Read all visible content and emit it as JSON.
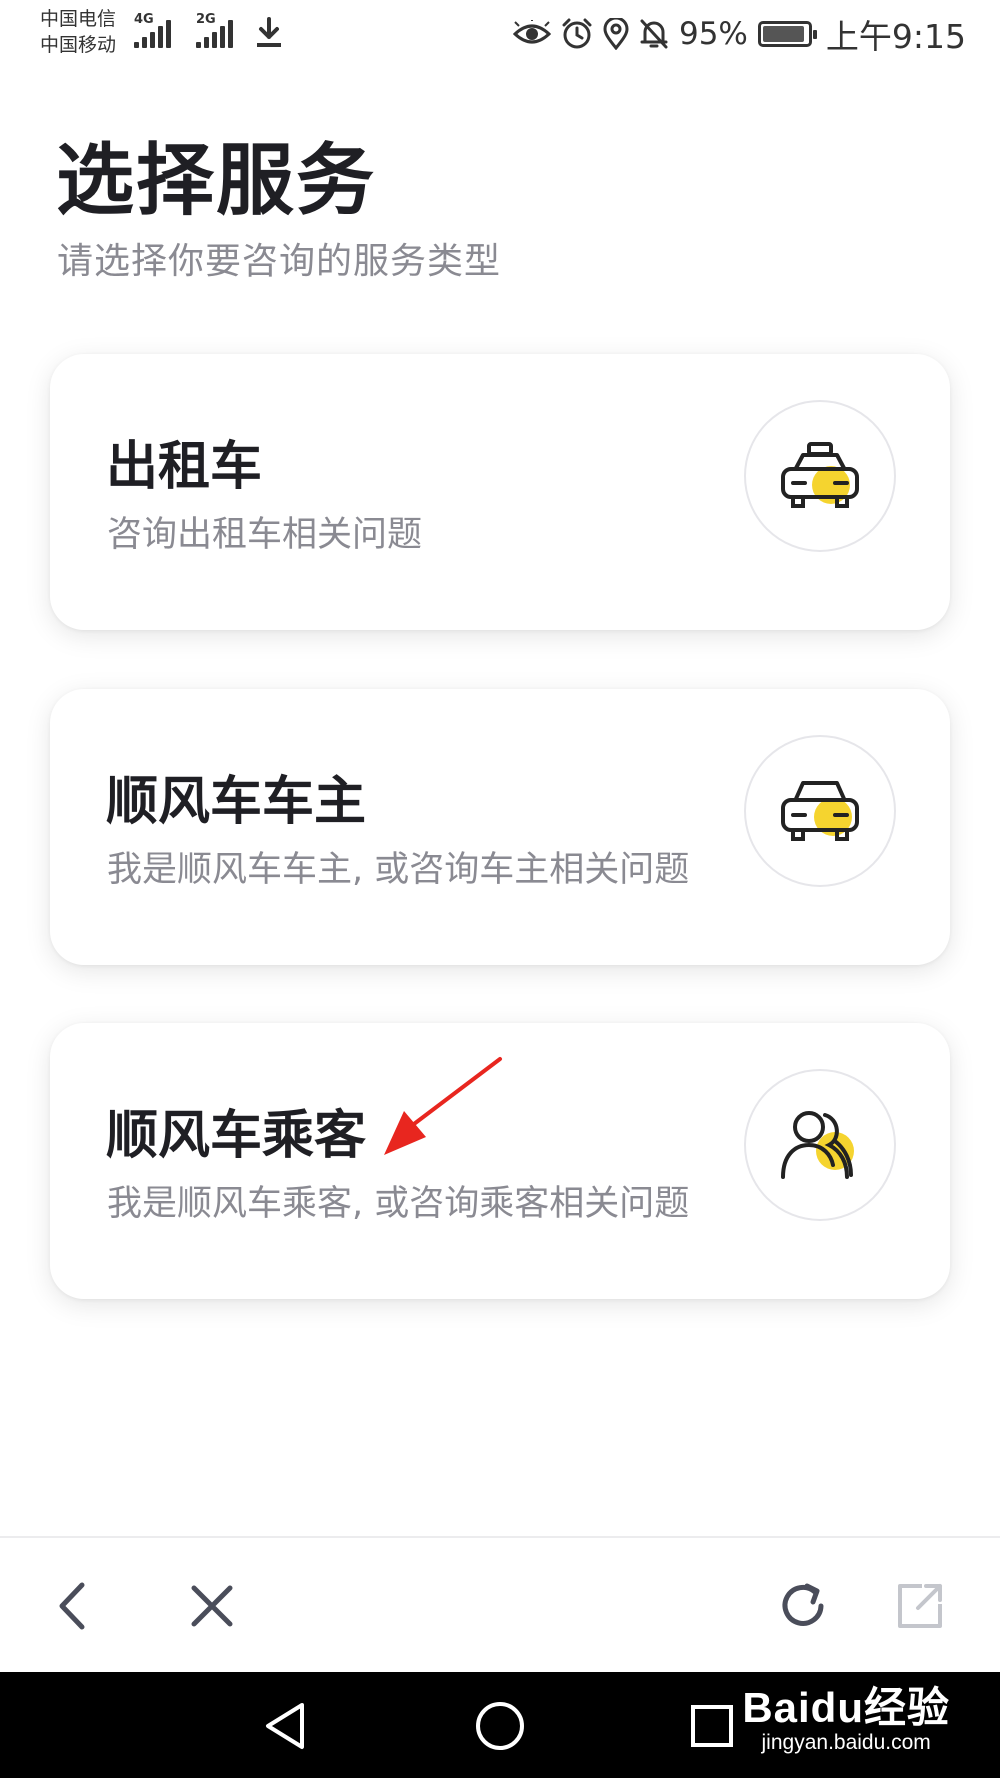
{
  "status_bar": {
    "carrier_1": "中国电信",
    "carrier_2": "中国移动",
    "network_1": "4G",
    "network_2": "2G",
    "battery_percent": "95%",
    "battery_level": 0.95,
    "time": "上午9:15",
    "icons": [
      "eye-icon",
      "alarm-icon",
      "location-icon",
      "notifications-off-icon",
      "battery-icon",
      "download-icon"
    ]
  },
  "header": {
    "title": "选择服务",
    "subtitle": "请选择你要咨询的服务类型"
  },
  "services": [
    {
      "title": "出租车",
      "description": "咨询出租车相关问题",
      "icon": "taxi-icon"
    },
    {
      "title": "顺风车车主",
      "description": "我是顺风车车主, 或咨询车主相关问题",
      "icon": "car-icon"
    },
    {
      "title": "顺风车乘客",
      "description": "我是顺风车乘客, 或咨询乘客相关问题",
      "icon": "passengers-icon"
    }
  ],
  "toolbar": {
    "buttons": [
      "back-icon",
      "close-icon",
      "refresh-icon",
      "share-icon"
    ]
  },
  "navbar": {
    "buttons": [
      "nav-back-icon",
      "nav-home-icon",
      "nav-recents-icon"
    ]
  },
  "watermark": {
    "brand": "Baidu经验",
    "url": "jingyan.baidu.com"
  },
  "colors": {
    "accent_yellow": "#f5d42f",
    "title_text": "#1f1f24",
    "secondary_text": "#8a8a92",
    "annotation_arrow": "#e8261f"
  }
}
